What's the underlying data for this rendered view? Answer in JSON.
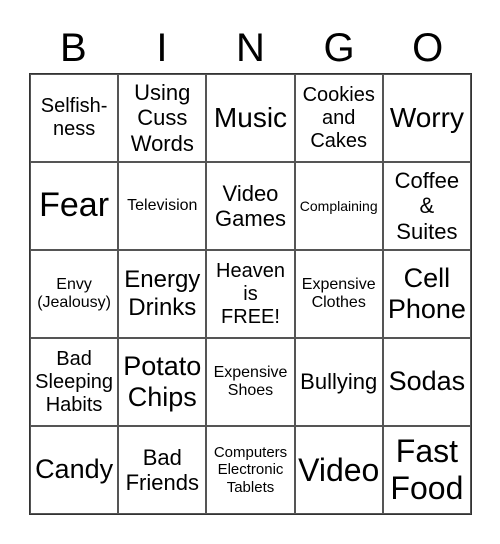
{
  "header": [
    "B",
    "I",
    "N",
    "G",
    "O"
  ],
  "cells": [
    "Selfish-\nness",
    "Using\nCuss\nWords",
    "Music",
    "Cookies\nand\nCakes",
    "Worry",
    "Fear",
    "Television",
    "Video\nGames",
    "Complaining",
    "Coffee\n&\nSuites",
    "Envy\n(Jealousy)",
    "Energy\nDrinks",
    "Heaven\nis\nFREE!",
    "Expensive\nClothes",
    "Cell\nPhone",
    "Bad\nSleeping\nHabits",
    "Potato\nChips",
    "Expensive\nShoes",
    "Bullying",
    "Sodas",
    "Candy",
    "Bad\nFriends",
    "Computers\nElectronic\nTablets",
    "Video",
    "Fast\nFood"
  ]
}
